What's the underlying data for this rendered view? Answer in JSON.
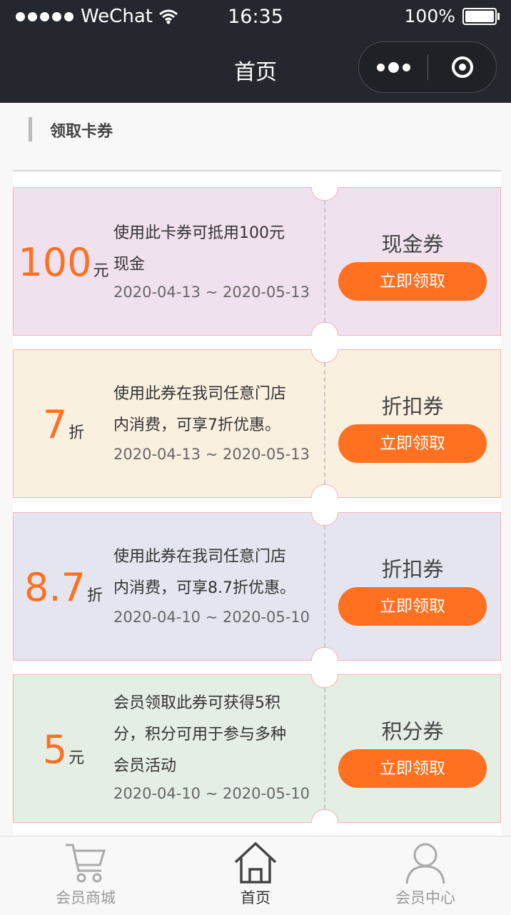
{
  "status_bar": {
    "carrier": "WeChat",
    "time": "16:35",
    "battery": "100%"
  },
  "nav": {
    "title": "首页"
  },
  "section": {
    "title": "领取卡券"
  },
  "coupons": [
    {
      "value": "100",
      "unit": "元",
      "desc_lines": [
        "使用此卡券可抵用100元",
        "现金"
      ],
      "date": "2020-04-13 ~ 2020-05-13",
      "type": "现金券",
      "button": "立即领取",
      "bg": "#f0e1ef"
    },
    {
      "value": "7",
      "unit": "折",
      "desc_lines": [
        "使用此券在我司任意门店",
        "内消费，可享7折优惠。"
      ],
      "date": "2020-04-13 ~ 2020-05-13",
      "type": "折扣券",
      "button": "立即领取",
      "bg": "#faf0e0"
    },
    {
      "value": "8.7",
      "unit": "折",
      "desc_lines": [
        "使用此券在我司任意门店",
        "内消费，可享8.7折优惠。"
      ],
      "date": "2020-04-10 ~ 2020-05-10",
      "type": "折扣券",
      "button": "立即领取",
      "bg": "#e5e5f0"
    },
    {
      "value": "5",
      "unit": "元",
      "desc_lines": [
        "会员领取此券可获得5积",
        "分，积分可用于参与多种",
        "会员活动"
      ],
      "date": "2020-04-10 ~ 2020-05-10",
      "type": "积分券",
      "button": "立即领取",
      "bg": "#e5eee5"
    }
  ],
  "tabbar": {
    "items": [
      {
        "label": "会员商城",
        "icon": "cart-icon",
        "active": false
      },
      {
        "label": "首页",
        "icon": "home-icon",
        "active": true
      },
      {
        "label": "会员中心",
        "icon": "user-icon",
        "active": false
      }
    ]
  },
  "colors": {
    "accent": "#ff7021",
    "topbar": "#24272d",
    "coupon_border": "#f5b3b6"
  }
}
